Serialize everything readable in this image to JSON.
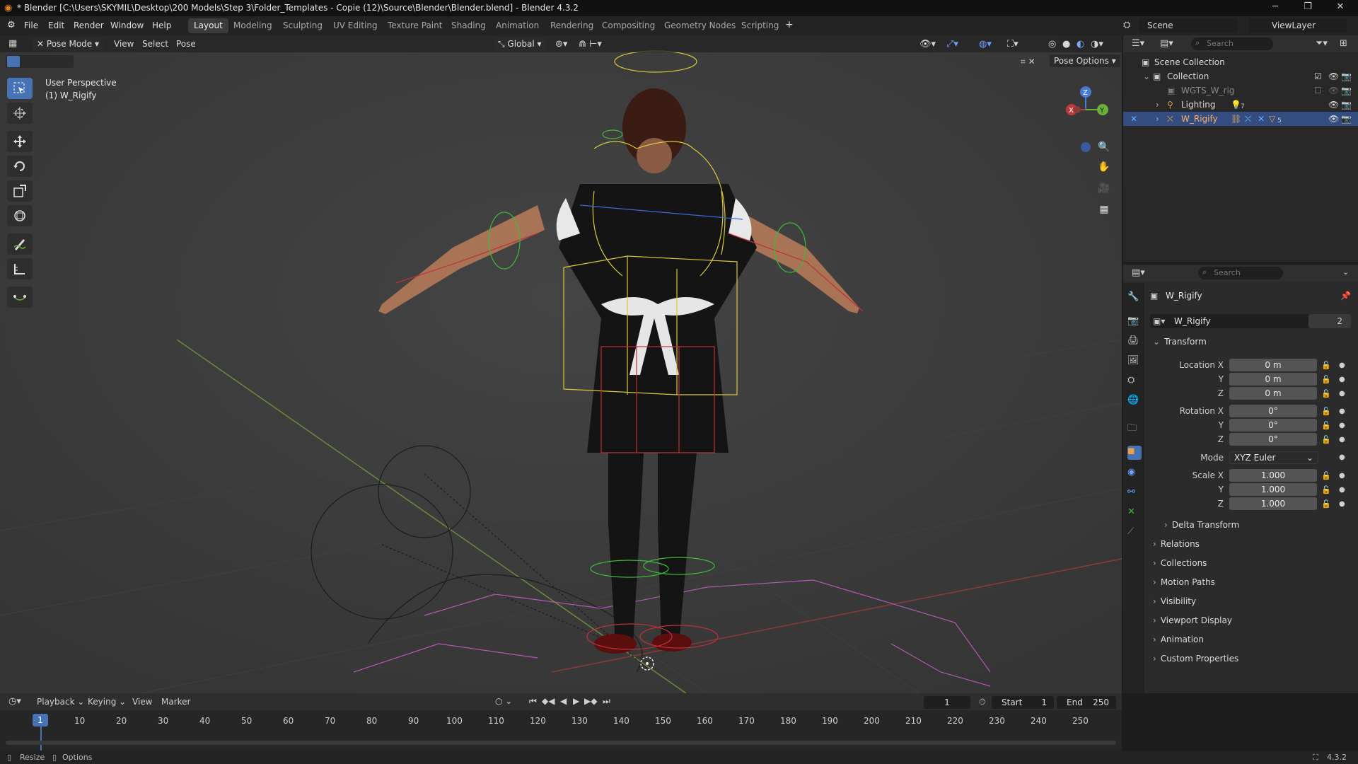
{
  "window": {
    "title": "* Blender [C:\\Users\\SKYMIL\\Desktop\\200 Models\\Step 3\\Folder_Templates - Copie (12)\\Source\\Blender\\Blender.blend] - Blender 4.3.2"
  },
  "menu": {
    "file": "File",
    "edit": "Edit",
    "render": "Render",
    "window": "Window",
    "help": "Help"
  },
  "workspaces": [
    "Layout",
    "Modeling",
    "Sculpting",
    "UV Editing",
    "Texture Paint",
    "Shading",
    "Animation",
    "Rendering",
    "Compositing",
    "Geometry Nodes",
    "Scripting"
  ],
  "scene": {
    "label": "Scene",
    "viewlayer": "ViewLayer"
  },
  "viewport_header": {
    "mode": "Pose Mode",
    "view": "View",
    "select": "Select",
    "pose": "Pose",
    "orientation": "Global",
    "pose_options": "Pose Options"
  },
  "viewport": {
    "perspective": "User Perspective",
    "object": "(1) W_Rigify",
    "gizmo": {
      "x": "X",
      "y": "Y",
      "z": "Z"
    }
  },
  "outliner": {
    "search_placeholder": "Search",
    "scene_collection": "Scene Collection",
    "collection": "Collection",
    "items": [
      {
        "label": "WGTS_W_rig"
      },
      {
        "label": "Lighting",
        "badge": "7"
      },
      {
        "label": "W_Rigify",
        "badge": "5"
      }
    ]
  },
  "properties": {
    "search_placeholder": "Search",
    "object_name": "W_Rigify",
    "data_name": "W_Rigify",
    "users": "2",
    "transform_label": "Transform",
    "location": {
      "label": "Location X",
      "x": "0 m",
      "y": "0 m",
      "z": "0 m"
    },
    "rotation": {
      "label": "Rotation X",
      "x": "0°",
      "y": "0°",
      "z": "0°"
    },
    "mode": {
      "label": "Mode",
      "value": "XYZ Euler"
    },
    "scale": {
      "label": "Scale X",
      "x": "1.000",
      "y": "1.000",
      "z": "1.000"
    },
    "axis_y": "Y",
    "axis_z": "Z",
    "delta_transform": "Delta Transform",
    "panels": [
      "Relations",
      "Collections",
      "Motion Paths",
      "Visibility",
      "Viewport Display",
      "Animation",
      "Custom Properties"
    ]
  },
  "timeline": {
    "playback": "Playback",
    "keying": "Keying",
    "view": "View",
    "marker": "Marker",
    "current_frame": "1",
    "start_label": "Start",
    "start": "1",
    "end_label": "End",
    "end": "250",
    "ticks": [
      "1",
      "10",
      "20",
      "30",
      "40",
      "50",
      "60",
      "70",
      "80",
      "90",
      "100",
      "110",
      "120",
      "130",
      "140",
      "150",
      "160",
      "170",
      "180",
      "190",
      "200",
      "210",
      "220",
      "230",
      "240",
      "250"
    ]
  },
  "status": {
    "resize": "Resize",
    "options": "Options",
    "version": "4.3.2"
  }
}
